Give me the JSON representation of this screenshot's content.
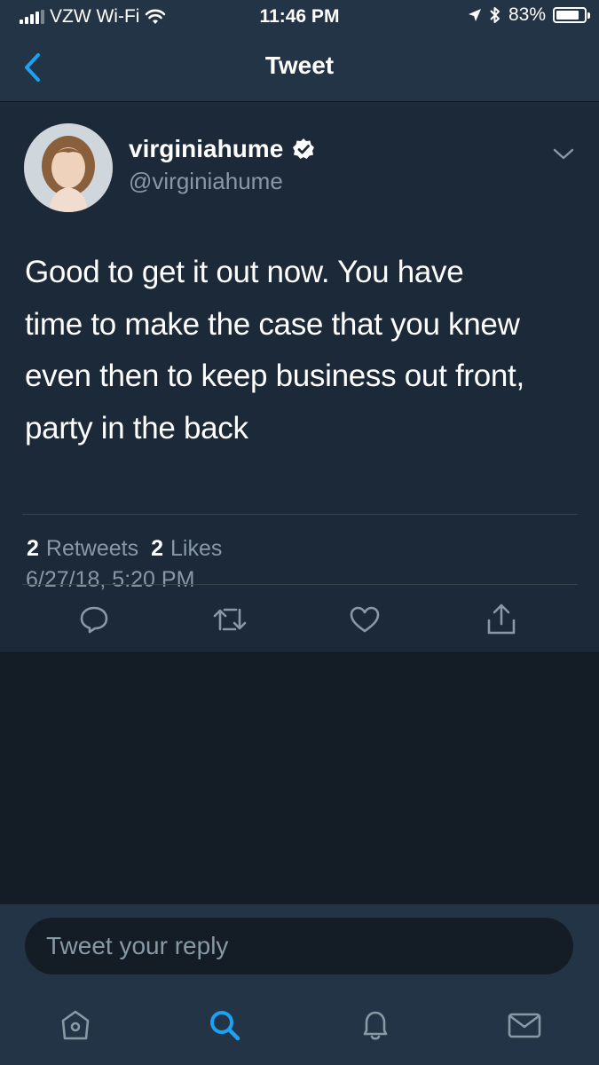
{
  "status_bar": {
    "carrier": "VZW Wi-Fi",
    "time": "11:46 PM",
    "battery_percent": "83%",
    "battery_level": 0.83
  },
  "nav": {
    "title": "Tweet",
    "back_icon": "chevron-left-icon"
  },
  "tweet": {
    "display_name": "virginiahume",
    "handle": "@virginiahume",
    "verified": true,
    "text": "Good to get it out now. You have\ntime to make the case that you knew\neven then to keep business out front,\nparty in the back",
    "timestamp": "6/27/18, 5:20 PM",
    "retweets_count": "2",
    "retweets_label": "Retweets",
    "likes_count": "2",
    "likes_label": "Likes"
  },
  "actions": [
    "reply-icon",
    "retweet-icon",
    "like-icon",
    "share-icon"
  ],
  "reply": {
    "placeholder": "Tweet your reply"
  },
  "tabbar": [
    "home-icon",
    "search-icon",
    "notifications-icon",
    "messages-icon"
  ],
  "colors": {
    "background": "#141d26",
    "card": "#1c2938",
    "bar": "#243447",
    "secondary_text": "#8899a6",
    "accent": "#1da1f2"
  }
}
